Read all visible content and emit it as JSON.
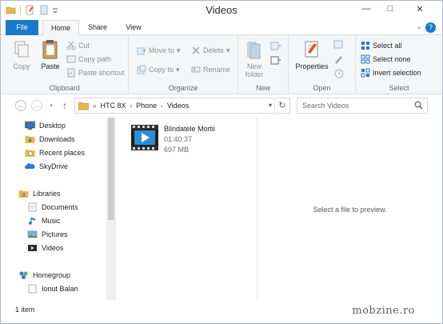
{
  "window": {
    "title": "Videos"
  },
  "ribbon_tabs": [
    "File",
    "Home",
    "Share",
    "View"
  ],
  "ribbon": {
    "clipboard": {
      "label": "Clipboard",
      "copy": "Copy",
      "paste": "Paste",
      "cut": "Cut",
      "copy_path": "Copy path",
      "paste_shortcut": "Paste shortcut"
    },
    "organize": {
      "label": "Organize",
      "move_to": "Move to",
      "copy_to": "Copy to",
      "delete": "Delete",
      "rename": "Rename"
    },
    "new": {
      "label": "New",
      "new_folder_line1": "New",
      "new_folder_line2": "folder"
    },
    "open": {
      "label": "Open",
      "properties": "Properties"
    },
    "select": {
      "label": "Select",
      "select_all": "Select all",
      "select_none": "Select none",
      "invert_selection": "Invert selection"
    }
  },
  "address": {
    "overflow": "«",
    "crumbs": [
      "HTC 8X",
      "Phone",
      "Videos"
    ],
    "separator": "›"
  },
  "search": {
    "placeholder": "Search Videos"
  },
  "nav_pane": {
    "favorites": [
      "Desktop",
      "Downloads",
      "Recent places",
      "SkyDrive"
    ],
    "libraries_header": "Libraries",
    "libraries": [
      "Documents",
      "Music",
      "Pictures",
      "Videos"
    ],
    "homegroup_header": "Homegroup",
    "homegroup": [
      "Ionut Balan"
    ]
  },
  "files": [
    {
      "name": "Blindatele Mortii",
      "duration": "01:40:37",
      "size": "697 MB"
    }
  ],
  "preview": {
    "message": "Select a file to preview."
  },
  "status": {
    "item_count": "1 item"
  },
  "watermark": "mobzine.ro",
  "colors": {
    "accent": "#1979ca",
    "folder": "#e8b84a",
    "video_icon": "#2a8fd6"
  }
}
